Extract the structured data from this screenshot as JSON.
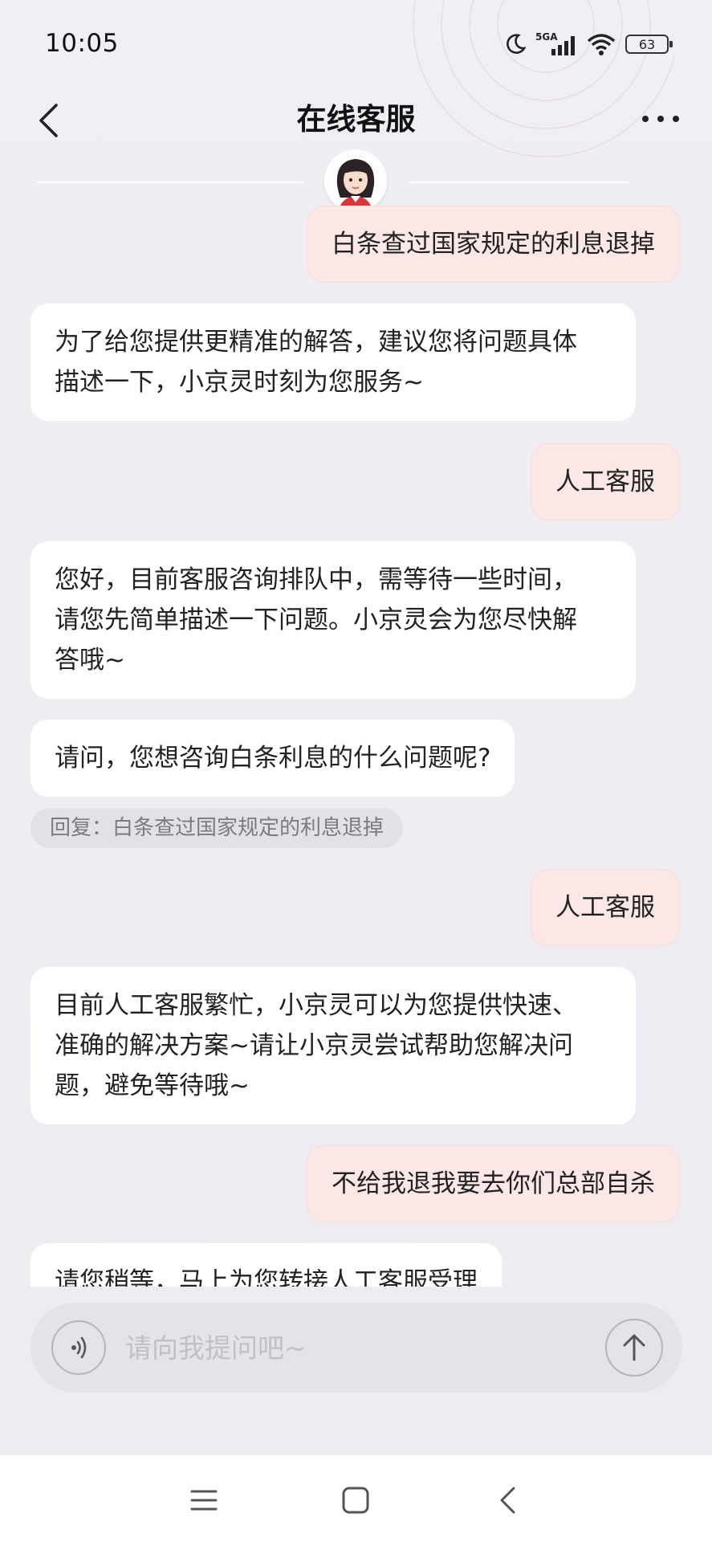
{
  "status_bar": {
    "time": "10:05",
    "network": "5GA",
    "battery": "63",
    "icons": [
      "moon-icon",
      "signal-icon",
      "wifi-icon",
      "battery-icon"
    ]
  },
  "header": {
    "title": "在线客服",
    "back_icon": "chevron-left-icon",
    "more_icon": "more-icon"
  },
  "messages": [
    {
      "from": "user",
      "text": "白条查过国家规定的利息退掉"
    },
    {
      "from": "bot",
      "lines": [
        "为了给您提供更精准的解答，建议您将问题具体",
        "描述一下，小京灵时刻为您服务~"
      ]
    },
    {
      "from": "user",
      "text": "人工客服"
    },
    {
      "from": "bot",
      "lines": [
        "您好，目前客服咨询排队中，需等待一些时间，",
        "请您先简单描述一下问题。小京灵会为您尽快解",
        "答哦~"
      ]
    },
    {
      "from": "bot",
      "text": "请问，您想咨询白条利息的什么问题呢?"
    },
    {
      "from": "user",
      "text": "人工客服"
    },
    {
      "from": "bot",
      "lines": [
        "目前人工客服繁忙，小京灵可以为您提供快速、",
        "准确的解决方案~请让小京灵尝试帮助您解决问",
        "题，避免等待哦~"
      ]
    },
    {
      "from": "user",
      "text": "不给我退我要去你们总部自杀"
    },
    {
      "from": "bot",
      "text": "请您稍等，马上为您转接人工客服受理"
    }
  ],
  "reply_reference": "回复：白条查过国家规定的利息退掉",
  "input": {
    "placeholder": "请向我提问吧~",
    "value": ""
  },
  "system_nav": [
    "menu-icon",
    "home-icon",
    "back-icon"
  ],
  "colors": {
    "user_bubble": "#fbe7e6",
    "bot_bubble": "#ffffff",
    "background": "#efedf2"
  }
}
